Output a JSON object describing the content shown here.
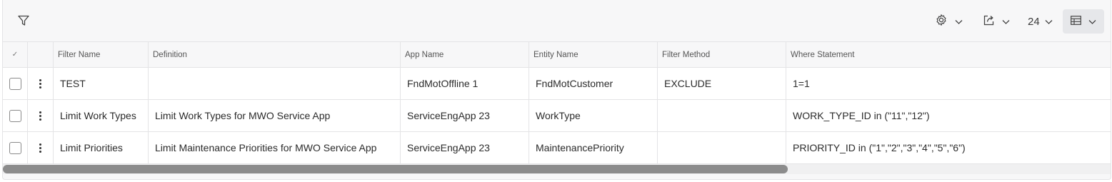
{
  "toolbar": {
    "filter_icon": "filter-funnel-icon",
    "settings_icon": "gear-icon",
    "export_icon": "export-icon",
    "page_size": "24",
    "view_icon": "table-view-icon"
  },
  "columns": {
    "select_all": "✓",
    "filter_name": "Filter Name",
    "definition": "Definition",
    "app_name": "App Name",
    "entity_name": "Entity Name",
    "filter_method": "Filter Method",
    "where_statement": "Where Statement"
  },
  "rows": [
    {
      "filter_name": "TEST",
      "definition": "",
      "app_name": "FndMotOffline 1",
      "entity_name": "FndMotCustomer",
      "filter_method": "EXCLUDE",
      "where_statement": "1=1"
    },
    {
      "filter_name": "Limit Work Types",
      "definition": "Limit Work Types for MWO Service App",
      "app_name": "ServiceEngApp 23",
      "entity_name": "WorkType",
      "filter_method": "",
      "where_statement": "WORK_TYPE_ID in (\"11\",\"12\")"
    },
    {
      "filter_name": "Limit Priorities",
      "definition": "Limit Maintenance Priorities for MWO Service App",
      "app_name": "ServiceEngApp 23",
      "entity_name": "MaintenancePriority",
      "filter_method": "",
      "where_statement": "PRIORITY_ID in (\"1\",\"2\",\"3\",\"4\",\"5\",\"6\")"
    }
  ]
}
